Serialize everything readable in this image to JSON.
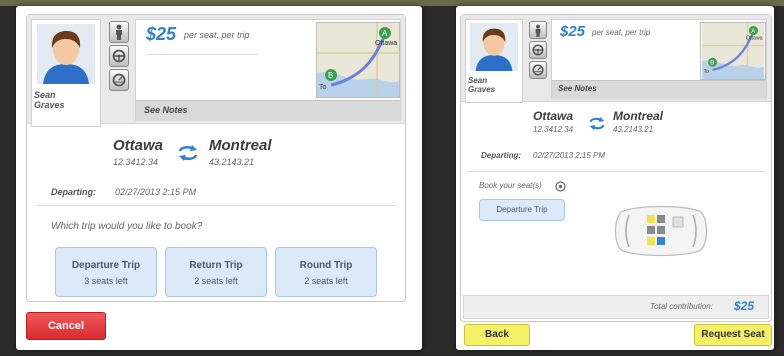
{
  "left_panel": {
    "driver_name_line1": "Sean",
    "driver_name_line2": "Graves",
    "price": "$25",
    "price_sub": "per seat, per trip",
    "map_labels": {
      "a": "A",
      "b": "B",
      "city_a": "Ottawa",
      "city_b": "To"
    },
    "notes_label": "See Notes",
    "origin": "Ottawa",
    "origin_coords": "12.3412.34",
    "destination": "Montreal",
    "destination_coords": "43.2143.21",
    "departing_label": "Departing:",
    "departing_value": "02/27/2013 2:15 PM",
    "question": "Which trip would you like to book?",
    "trips": [
      {
        "title": "Departure Trip",
        "seats": "3 seats left"
      },
      {
        "title": "Return Trip",
        "seats": "2 seats left"
      },
      {
        "title": "Round Trip",
        "seats": "2 seats left"
      }
    ],
    "cancel_label": "Cancel"
  },
  "right_panel": {
    "driver_name_line1": "Sean",
    "driver_name_line2": "Graves",
    "price": "$25",
    "price_sub": "per seat, per trip",
    "map_labels": {
      "a": "A",
      "b": "B",
      "city_a": "Ottawa",
      "city_b": "To"
    },
    "notes_label": "See Notes",
    "origin": "Ottawa",
    "origin_coords": "12.3412.34",
    "destination": "Montreal",
    "destination_coords": "43.2143.21",
    "departing_label": "Departing:",
    "departing_value": "02/27/2013 2:15 PM",
    "book_label": "Book your seat(s)",
    "departure_trip_label": "Departure Trip",
    "total_label": "Total contribution:",
    "total_value": "$25",
    "back_label": "Back",
    "request_label": "Request Seat"
  },
  "colors": {
    "accent_blue": "#2f7fd6",
    "cancel_red": "#e2383c",
    "yellow_button": "#f5f066",
    "seat_yellow": "#f3e34a",
    "seat_blue": "#2f86e0",
    "seat_gray": "#8a8a8a"
  },
  "icons": [
    "person-icon",
    "steering-wheel-icon",
    "speedometer-icon",
    "swap-arrows-icon",
    "help-icon",
    "car-top-icon"
  ]
}
